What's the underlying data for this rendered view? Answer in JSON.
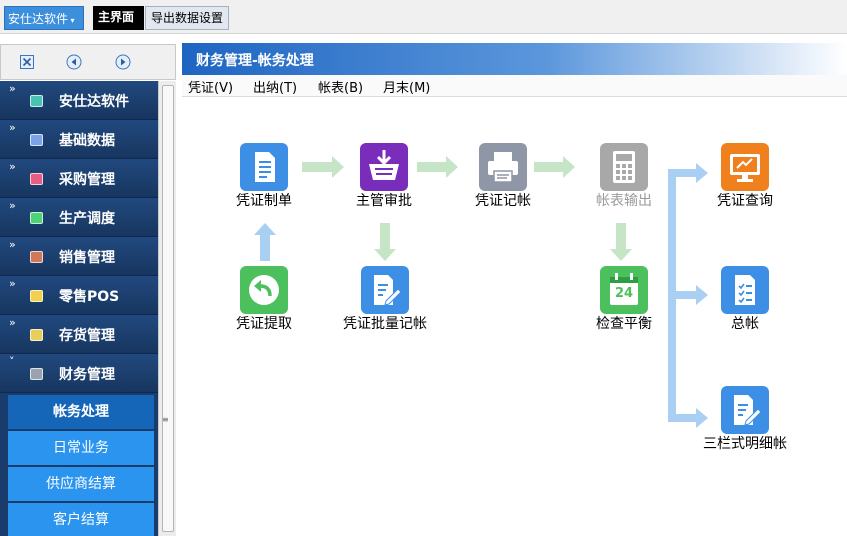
{
  "topbar": {
    "app_menu_label": "安仕达软件",
    "tabs": [
      "主界面",
      "导出数据设置"
    ]
  },
  "sidebar": {
    "items": [
      {
        "label": "安仕达软件",
        "icon": "app-icon",
        "color": "#49c2b4"
      },
      {
        "label": "基础数据",
        "icon": "base-data-icon",
        "color": "#7aa3e8"
      },
      {
        "label": "采购管理",
        "icon": "purchase-icon",
        "color": "#e85d82"
      },
      {
        "label": "生产调度",
        "icon": "production-icon",
        "color": "#4fd37a"
      },
      {
        "label": "销售管理",
        "icon": "sales-icon",
        "color": "#d0785a"
      },
      {
        "label": "零售POS",
        "icon": "pos-icon",
        "color": "#f2d04e"
      },
      {
        "label": "存货管理",
        "icon": "inventory-icon",
        "color": "#e8cf5c"
      },
      {
        "label": "财务管理",
        "icon": "finance-icon",
        "color": "#9aa3b0"
      }
    ],
    "subitems": [
      "帐务处理",
      "日常业务",
      "供应商结算",
      "客户结算"
    ],
    "active_subitem": "帐务处理"
  },
  "panel": {
    "title": "财务管理-帐务处理",
    "menu": [
      "凭证(V)",
      "出纳(T)",
      "帐表(B)",
      "月末(M)"
    ]
  },
  "flow": {
    "voucher_create": "凭证制单",
    "supervisor_approve": "主管审批",
    "voucher_post": "凭证记帐",
    "report_output": "帐表输出",
    "voucher_query": "凭证查询",
    "voucher_fetch": "凭证提取",
    "batch_post": "凭证批量记帐",
    "balance_check": "检查平衡",
    "calendar_day": "24",
    "general_ledger": "总帐",
    "three_column_ledger": "三栏式明细帐"
  },
  "colors": {
    "blue_icon": "#3d8fe6",
    "purple_icon": "#7a2dba",
    "gray_icon": "#8f97a6",
    "orange_icon": "#f07f1e",
    "green_icon": "#4cc05c",
    "arrow_green": "#c6e5c6",
    "arrow_blue": "#a9cff3"
  }
}
